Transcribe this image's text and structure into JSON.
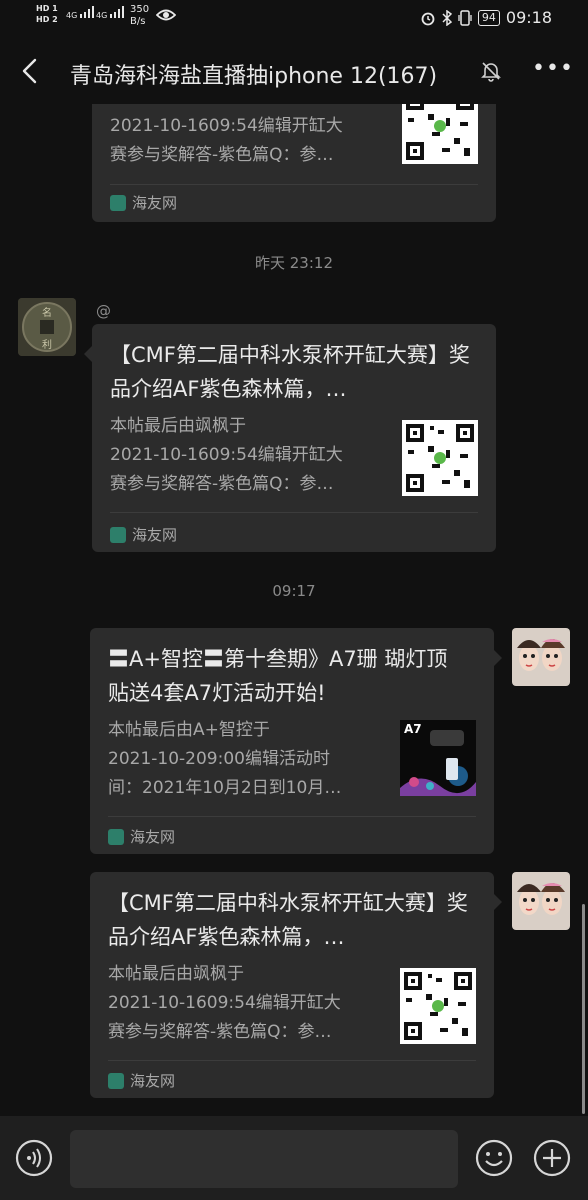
{
  "status_bar": {
    "hd1": "HD 1",
    "hd2": "HD 2",
    "sig1": "4G",
    "sig2": "4G",
    "speed_value": "350",
    "speed_unit": "B/s",
    "battery": "94",
    "time": "09:18"
  },
  "header": {
    "title": "青岛海科海盐直播抽iphone 12(167)",
    "more": "•••"
  },
  "messages": [
    {
      "desc": [
        "2021-10-1609:54编辑开缸大",
        "赛参与奖解答-紫色篇Q：参…"
      ],
      "source": "海友网"
    },
    {
      "time": "昨天 23:12",
      "nick": "@",
      "title": "【CMF第二届中科水泵杯开缸大赛】奖品介绍AF紫色森林篇，…",
      "desc": [
        "本帖最后由飒枫于",
        "2021-10-1609:54编辑开缸大",
        "赛参与奖解答-紫色篇Q：参…"
      ],
      "source": "海友网"
    },
    {
      "time": "09:17",
      "title": "〓A+智控〓第十叁期》A7珊 瑚灯顶贴送4套A7灯活动开始!",
      "desc": [
        "本帖最后由A+智控于",
        "2021-10-209:00编辑活动时",
        "间：2021年10月2日到10月…"
      ],
      "thumb_label": "A7",
      "source": "海友网"
    },
    {
      "title": "【CMF第二届中科水泵杯开缸大赛】奖品介绍AF紫色森林篇，…",
      "desc": [
        "本帖最后由飒枫于",
        "2021-10-1609:54编辑开缸大",
        "赛参与奖解答-紫色篇Q：参…"
      ],
      "source": "海友网"
    }
  ],
  "colors": {
    "background": "#111111",
    "card": "#2c2c2c",
    "source_icon": "#2d7f6a"
  }
}
